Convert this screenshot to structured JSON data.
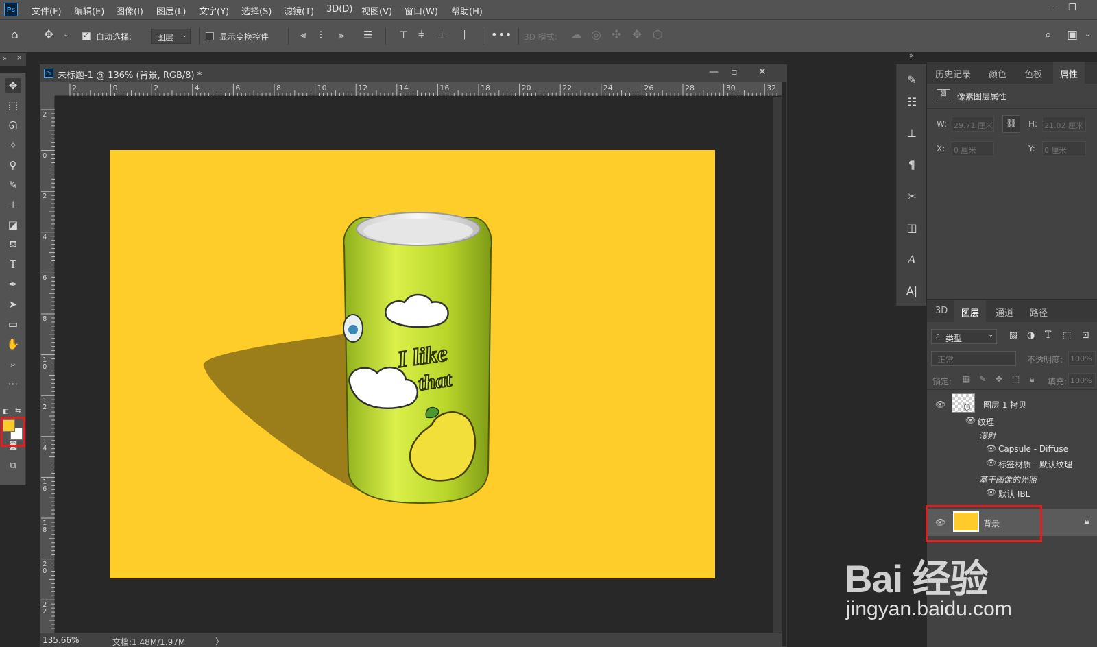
{
  "app": {
    "logo": "Ps",
    "menu": [
      "文件(F)",
      "编辑(E)",
      "图像(I)",
      "图层(L)",
      "文字(Y)",
      "选择(S)",
      "滤镜(T)",
      "3D(D)",
      "视图(V)",
      "窗口(W)",
      "帮助(H)"
    ],
    "window_controls": {
      "minimize": "—",
      "restore": "❐"
    }
  },
  "options_bar": {
    "auto_select_label": "自动选择:",
    "auto_select_checked": true,
    "auto_select_target": "图层",
    "show_transform_label": "显示变换控件",
    "show_transform_checked": false,
    "more": "•••",
    "mode_3d_label": "3D 模式:"
  },
  "document": {
    "title": "未标题-1 @ 136% (背景, RGB/8) *",
    "ruler_h": [
      "2",
      "0",
      "2",
      "4",
      "6",
      "8",
      "10",
      "12",
      "14",
      "16",
      "18",
      "20",
      "22",
      "24",
      "26",
      "28",
      "30",
      "32"
    ],
    "ruler_v": [
      "2",
      "0",
      "2",
      "4",
      "6",
      "8",
      "10",
      "12",
      "14",
      "16",
      "18",
      "20",
      "22"
    ],
    "zoom": "135.66%",
    "doc_size": "文档:1.48M/1.97M",
    "status_arrow": "〉",
    "canvas_color": "#ffcd2a",
    "can_text_1": "I like",
    "can_text_2": "that"
  },
  "tools": {
    "foreground_color": "#ffcb2b",
    "background_color": "#ffffff"
  },
  "properties_panel": {
    "tabs": [
      "历史记录",
      "颜色",
      "色板",
      "属性"
    ],
    "active_tab": "属性",
    "header": "像素图层属性",
    "w_label": "W:",
    "w_value": "29.71 厘米",
    "h_label": "H:",
    "h_value": "21.02 厘米",
    "x_label": "X:",
    "x_value": "0 厘米",
    "y_label": "Y:",
    "y_value": "0 厘米"
  },
  "layers_panel": {
    "tabs": [
      "3D",
      "图层",
      "通道",
      "路径"
    ],
    "active_tab": "图层",
    "filter_label": "类型",
    "blend_mode": "正常",
    "opacity_label": "不透明度:",
    "opacity_value": "100%",
    "lock_label": "锁定:",
    "fill_label": "填充:",
    "fill_value": "100%",
    "layers": [
      {
        "name": "图层 1 拷贝"
      },
      {
        "name": "纹理"
      },
      {
        "name": "漫射"
      },
      {
        "name": "Capsule - Diffuse"
      },
      {
        "name": "标签材质 - 默认纹理"
      },
      {
        "name": "基于图像的光照"
      },
      {
        "name": "默认 IBL"
      },
      {
        "name": "背景"
      }
    ]
  },
  "watermark": {
    "main": "Bai 经验",
    "sub": "jingyan.baidu.com"
  }
}
